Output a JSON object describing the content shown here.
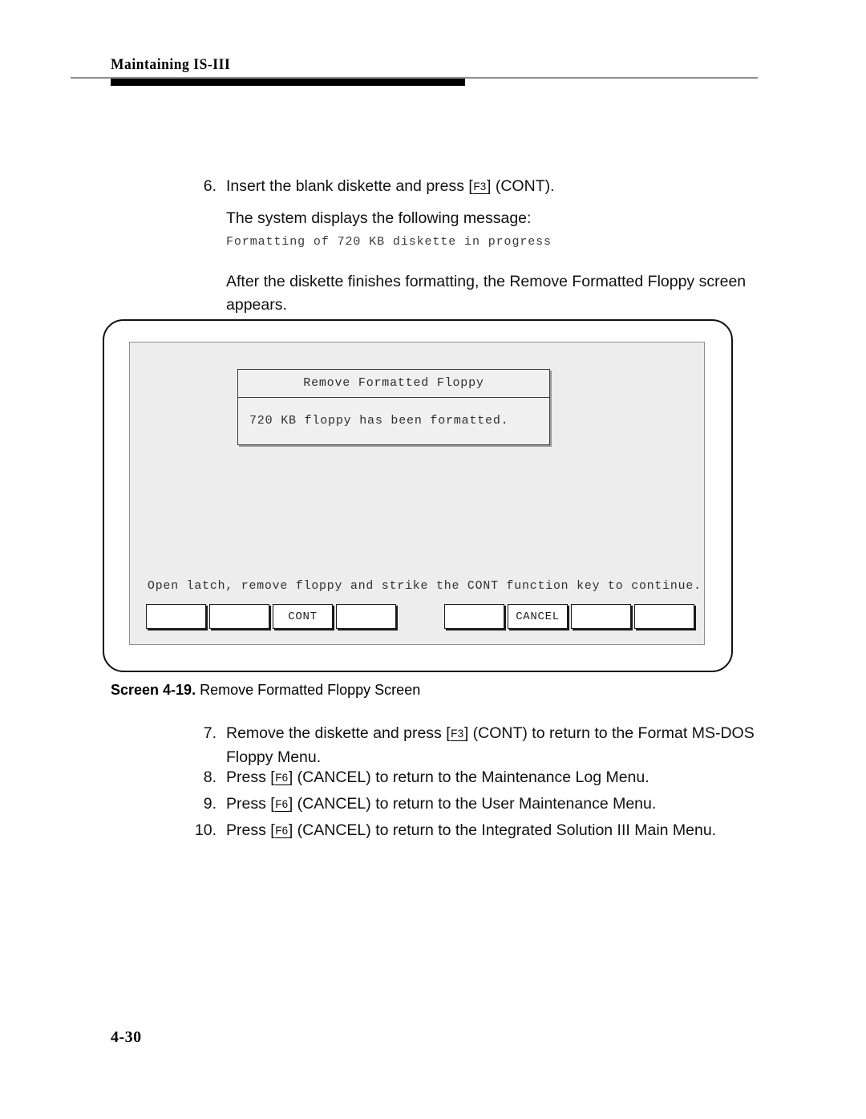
{
  "header": {
    "title": "Maintaining IS-III"
  },
  "steps": {
    "step6": {
      "number": "6.",
      "text_before": "Insert the blank diskette and press [",
      "key": "F3",
      "text_after": "] (CONT)."
    },
    "step6_para": "The system displays the following message:",
    "step6_message": "Formatting of 720 KB diskette in progress",
    "step6_after": {
      "line1": "After the diskette finishes formatting, the Remove Formatted Floppy screen",
      "line2": "appears."
    },
    "step7": {
      "number": "7.",
      "text_before": "Remove the diskette and press [",
      "key": "F3",
      "text_after": "] (CONT) to return to the Format MS-DOS",
      "line2": "Floppy Menu."
    },
    "step8": {
      "number": "8.",
      "text_before": "Press [",
      "key": "F6",
      "text_after": "] (CANCEL) to return to the Maintenance Log Menu."
    },
    "step9": {
      "number": "9.",
      "text_before": "Press [",
      "key": "F6",
      "text_after": "] (CANCEL) to return to the User Maintenance Menu."
    },
    "step10": {
      "number": "10.",
      "text_before": "Press [",
      "key": "F6",
      "text_after": "] (CANCEL) to return to the Integrated Solution III Main Menu."
    }
  },
  "terminal": {
    "dialog": {
      "title": "Remove Formatted Floppy",
      "body": "720 KB floppy has been formatted."
    },
    "status_line": "Open latch, remove floppy and strike the CONT function key to continue.",
    "softkeys_left": [
      "",
      "",
      "CONT",
      ""
    ],
    "softkeys_right": [
      "",
      "CANCEL",
      "",
      ""
    ]
  },
  "caption": {
    "label": "Screen 4-19.",
    "text": "Remove Formatted Floppy Screen"
  },
  "folio": "4-30"
}
